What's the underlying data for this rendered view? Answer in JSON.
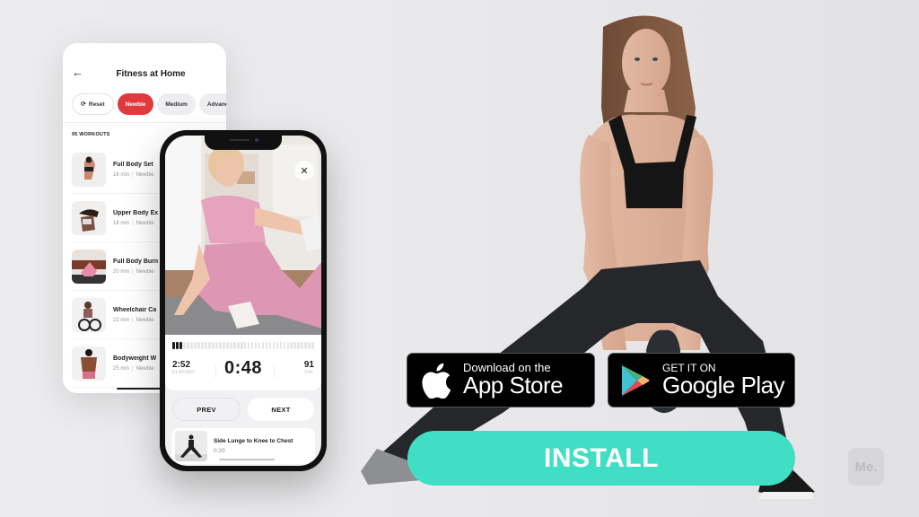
{
  "list_screen": {
    "title": "Fitness at Home",
    "back_icon": "arrow-left-icon",
    "filters": [
      {
        "label": "Reset",
        "icon": "refresh-icon",
        "state": "outlined"
      },
      {
        "label": "Newbie",
        "state": "active"
      },
      {
        "label": "Medium",
        "state": "default"
      },
      {
        "label": "Advance",
        "state": "default"
      }
    ],
    "count_label": "95 WORKOUTS",
    "workouts": [
      {
        "name": "Full Body Set",
        "duration": "16 min",
        "level": "Newbie"
      },
      {
        "name": "Upper Body Ex",
        "duration": "18 min",
        "level": "Newbie"
      },
      {
        "name": "Full Body Burn",
        "duration": "20 min",
        "level": "Newbie"
      },
      {
        "name": "Wheelchair Ca",
        "duration": "22 min",
        "level": "Newbie"
      },
      {
        "name": "Bodyweight W",
        "duration": "25 min",
        "level": "Newbie"
      }
    ]
  },
  "player_screen": {
    "close_icon": "close-icon",
    "progress": {
      "completed_segments": 3,
      "total_segments": 40
    },
    "elapsed": {
      "value": "2:52",
      "label": "ELAPSED"
    },
    "timer": "0:48",
    "calories": {
      "value": "91",
      "label": "CAL"
    },
    "prev_label": "PREV",
    "next_label": "NEXT",
    "next_exercise": {
      "name": "Side Lunge to Knee to Chest",
      "duration": "0:20"
    }
  },
  "store_badges": {
    "apple": {
      "small": "Download on the",
      "big": "App Store",
      "icon": "apple-icon"
    },
    "google": {
      "small": "GET IT ON",
      "big": "Google Play",
      "icon": "google-play-icon"
    }
  },
  "install_label": "INSTALL",
  "brand_logo": "Me.",
  "colors": {
    "accent_install": "#40dfc5",
    "chip_active": "#e0393e",
    "background": "#ececee"
  }
}
